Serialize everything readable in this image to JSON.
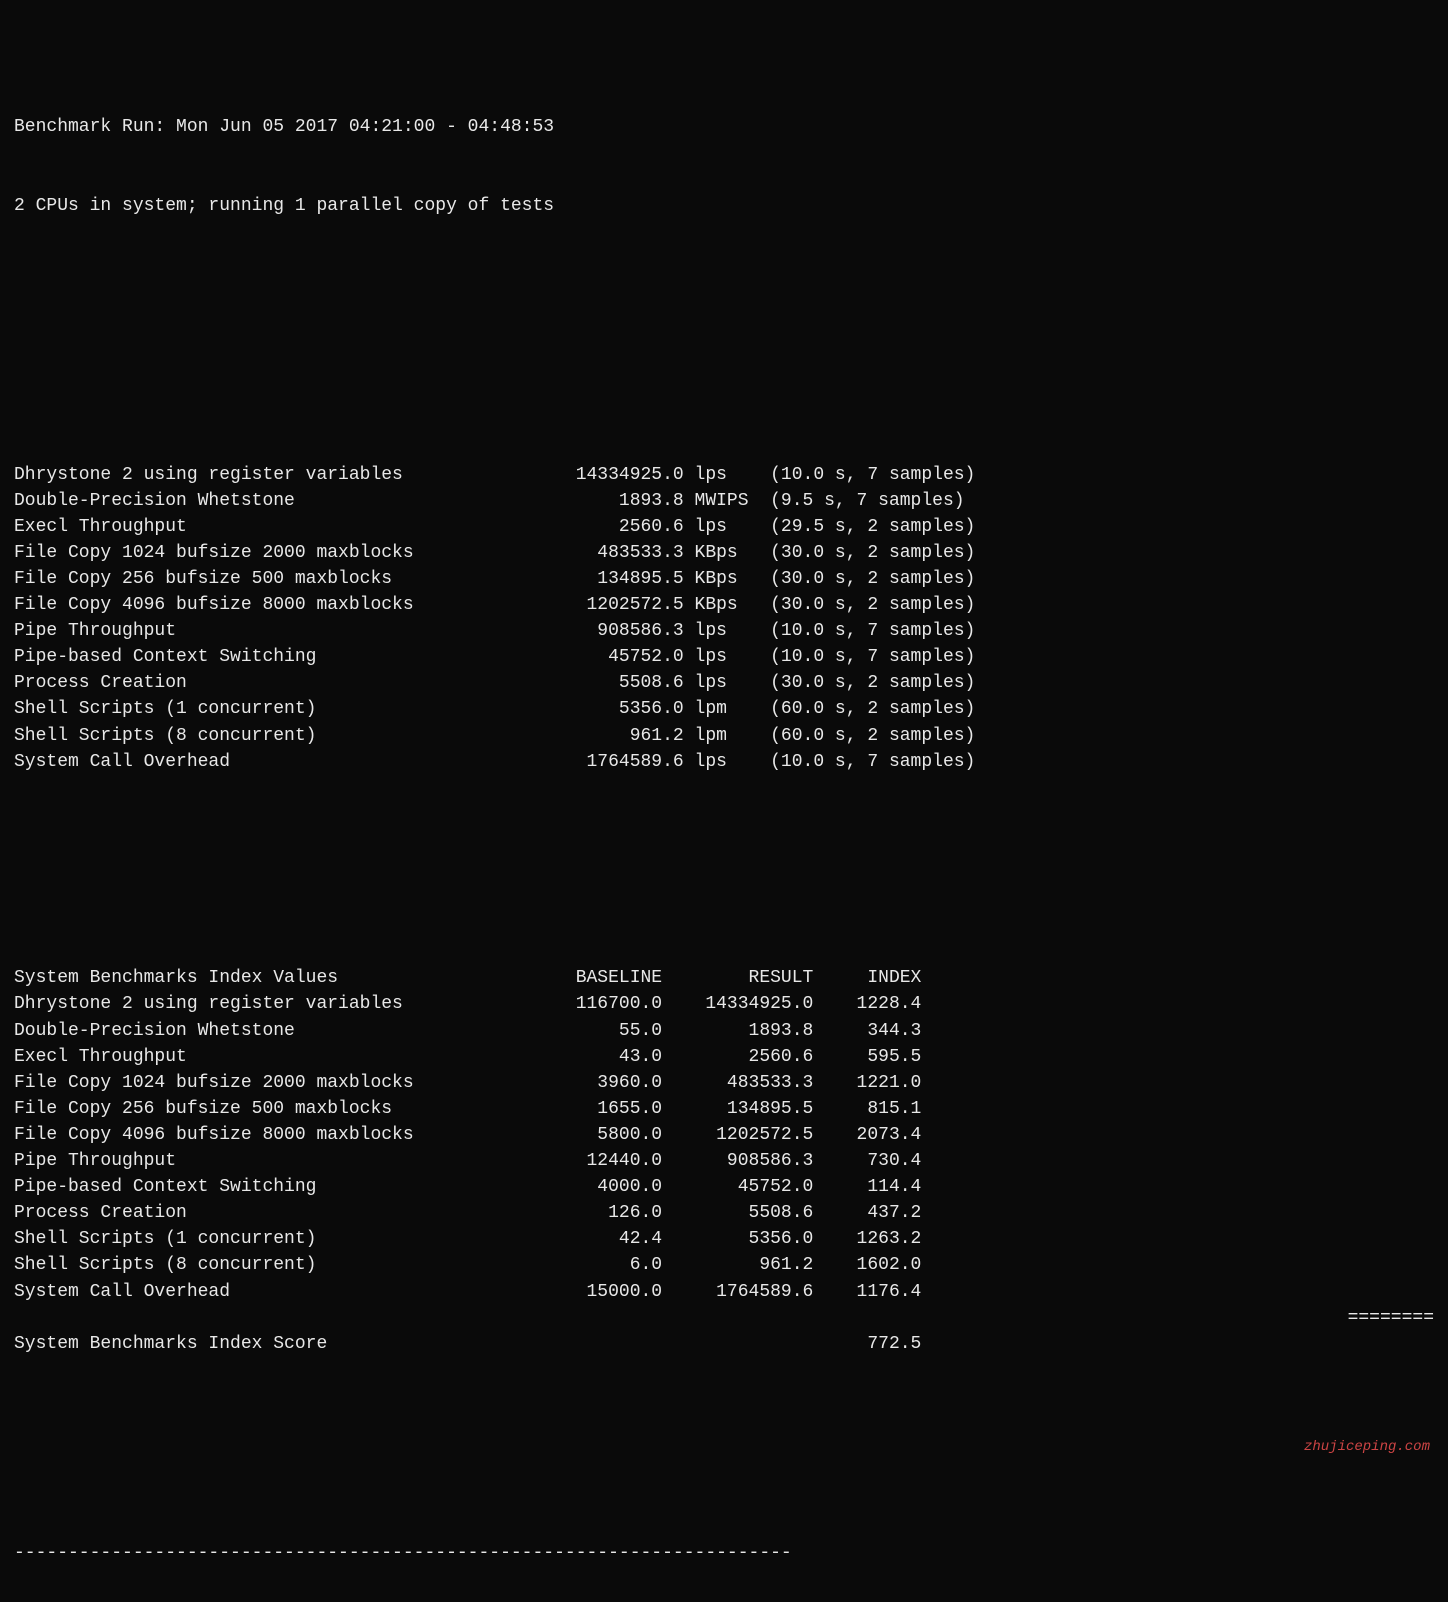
{
  "header": {
    "line1": "Benchmark Run: Mon Jun 05 2017 04:21:00 - 04:48:53",
    "line2": "2 CPUs in system; running 1 parallel copy of tests"
  },
  "raw_results": {
    "items": [
      {
        "name": "Dhrystone 2 using register variables",
        "value": "14334925.0",
        "unit": "lps",
        "details": "(10.0 s, 7 samples)"
      },
      {
        "name": "Double-Precision Whetstone",
        "value": "1893.8",
        "unit": "MWIPS",
        "details": "(9.5 s, 7 samples)"
      },
      {
        "name": "Execl Throughput",
        "value": "2560.6",
        "unit": "lps",
        "details": "(29.5 s, 2 samples)"
      },
      {
        "name": "File Copy 1024 bufsize 2000 maxblocks",
        "value": "483533.3",
        "unit": "KBps",
        "details": "(30.0 s, 2 samples)"
      },
      {
        "name": "File Copy 256 bufsize 500 maxblocks",
        "value": "134895.5",
        "unit": "KBps",
        "details": "(30.0 s, 2 samples)"
      },
      {
        "name": "File Copy 4096 bufsize 8000 maxblocks",
        "value": "1202572.5",
        "unit": "KBps",
        "details": "(30.0 s, 2 samples)"
      },
      {
        "name": "Pipe Throughput",
        "value": "908586.3",
        "unit": "lps",
        "details": "(10.0 s, 7 samples)"
      },
      {
        "name": "Pipe-based Context Switching",
        "value": "45752.0",
        "unit": "lps",
        "details": "(10.0 s, 7 samples)"
      },
      {
        "name": "Process Creation",
        "value": "5508.6",
        "unit": "lps",
        "details": "(30.0 s, 2 samples)"
      },
      {
        "name": "Shell Scripts (1 concurrent)",
        "value": "5356.0",
        "unit": "lpm",
        "details": "(60.0 s, 2 samples)"
      },
      {
        "name": "Shell Scripts (8 concurrent)",
        "value": "961.2",
        "unit": "lpm",
        "details": "(60.0 s, 2 samples)"
      },
      {
        "name": "System Call Overhead",
        "value": "1764589.6",
        "unit": "lps",
        "details": "(10.0 s, 7 samples)"
      }
    ]
  },
  "index_table": {
    "headers": {
      "col1": "BASELINE",
      "col2": "RESULT",
      "col3": "INDEX"
    },
    "section_title": "System Benchmarks Index Values",
    "items": [
      {
        "name": "Dhrystone 2 using register variables",
        "baseline": "116700.0",
        "result": "14334925.0",
        "index": "1228.4"
      },
      {
        "name": "Double-Precision Whetstone",
        "baseline": "55.0",
        "result": "1893.8",
        "index": "344.3"
      },
      {
        "name": "Execl Throughput",
        "baseline": "43.0",
        "result": "2560.6",
        "index": "595.5"
      },
      {
        "name": "File Copy 1024 bufsize 2000 maxblocks",
        "baseline": "3960.0",
        "result": "483533.3",
        "index": "1221.0"
      },
      {
        "name": "File Copy 256 bufsize 500 maxblocks",
        "baseline": "1655.0",
        "result": "134895.5",
        "index": "815.1"
      },
      {
        "name": "File Copy 4096 bufsize 8000 maxblocks",
        "baseline": "5800.0",
        "result": "1202572.5",
        "index": "2073.4"
      },
      {
        "name": "Pipe Throughput",
        "baseline": "12440.0",
        "result": "908586.3",
        "index": "730.4"
      },
      {
        "name": "Pipe-based Context Switching",
        "baseline": "4000.0",
        "result": "45752.0",
        "index": "114.4"
      },
      {
        "name": "Process Creation",
        "baseline": "126.0",
        "result": "5508.6",
        "index": "437.2"
      },
      {
        "name": "Shell Scripts (1 concurrent)",
        "baseline": "42.4",
        "result": "5356.0",
        "index": "1263.2"
      },
      {
        "name": "Shell Scripts (8 concurrent)",
        "baseline": "6.0",
        "result": "961.2",
        "index": "1602.0"
      },
      {
        "name": "System Call Overhead",
        "baseline": "15000.0",
        "result": "1764589.6",
        "index": "1176.4"
      }
    ],
    "equals_line": "========",
    "score_label": "System Benchmarks Index Score",
    "score_value": "772.5"
  },
  "watermark": "zhujiceping.com",
  "divider": "------------------------------------------------------------------------"
}
